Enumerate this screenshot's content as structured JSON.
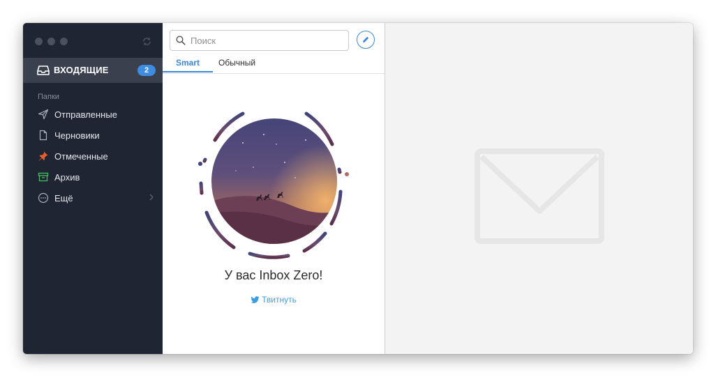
{
  "sidebar": {
    "inbox": {
      "label": "ВХОДЯЩИЕ",
      "count": "2"
    },
    "section_label": "Папки",
    "folders": [
      {
        "label": "Отправленные",
        "icon": "paper-plane-icon"
      },
      {
        "label": "Черновики",
        "icon": "document-icon"
      },
      {
        "label": "Отмеченные",
        "icon": "pin-icon"
      },
      {
        "label": "Архив",
        "icon": "archive-icon"
      },
      {
        "label": "Ещё",
        "icon": "more-icon"
      }
    ]
  },
  "search": {
    "placeholder": "Поиск"
  },
  "tabs": [
    {
      "label": "Smart",
      "active": true
    },
    {
      "label": "Обычный",
      "active": false
    }
  ],
  "empty_state": {
    "title": "У вас Inbox Zero!",
    "tweet_label": "Твитнуть"
  },
  "colors": {
    "sidebar_bg": "#1f2532",
    "accent": "#3a87d6",
    "badge": "#3f8de0",
    "twitter": "#3a9ee0",
    "pin": "#e85d2c",
    "archive": "#3cc460"
  }
}
